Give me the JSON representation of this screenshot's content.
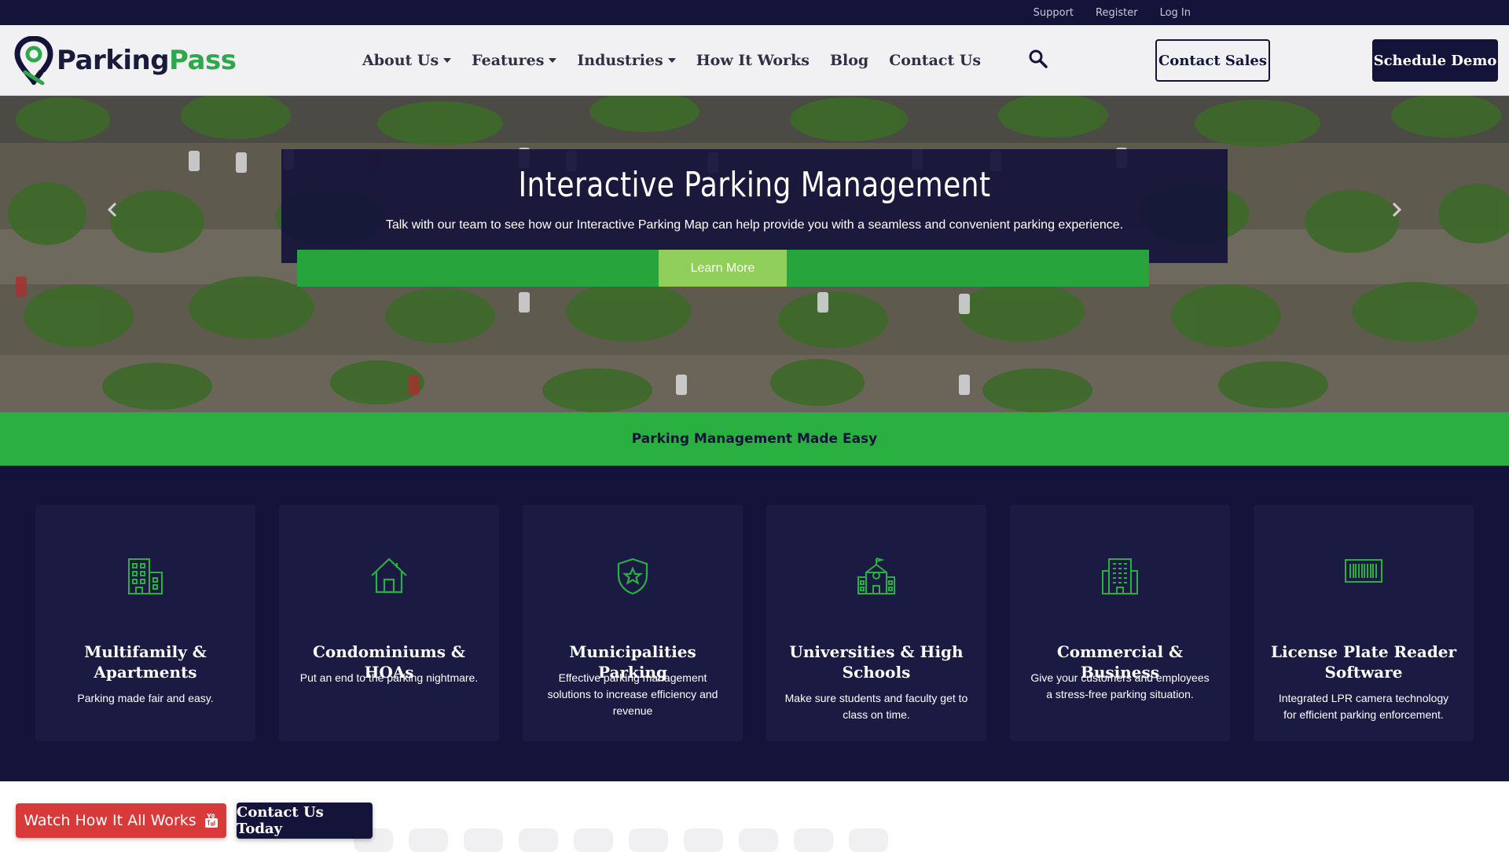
{
  "utility": {
    "links": [
      "Support",
      "Register",
      "Log In"
    ]
  },
  "brand": {
    "part1": "Parking",
    "part2": "Pass",
    "colors": {
      "navy": "#14133a",
      "green": "#2ea84a"
    }
  },
  "nav": {
    "items": [
      {
        "label": "About Us",
        "dropdown": true
      },
      {
        "label": "Features",
        "dropdown": true
      },
      {
        "label": "Industries",
        "dropdown": true
      },
      {
        "label": "How It Works",
        "dropdown": false
      },
      {
        "label": "Blog",
        "dropdown": false
      },
      {
        "label": "Contact Us",
        "dropdown": false
      }
    ],
    "search_icon": "search-icon",
    "contact_sales": "Contact Sales",
    "schedule_demo": "Schedule Demo"
  },
  "hero": {
    "title": "Interactive Parking Management",
    "subtitle": "Talk with our team to see how our Interactive Parking Map can help provide you with a seamless and convenient parking experience.",
    "cta": "Learn More"
  },
  "tagline": "Parking Management Made Easy",
  "industries": [
    {
      "icon": "apartment-building-icon",
      "title": "Multifamily & Apartments",
      "desc": "Parking made fair and easy."
    },
    {
      "icon": "house-icon",
      "title": "Condominiums & HOAs",
      "desc": "Put an end to the parking nightmare."
    },
    {
      "icon": "shield-star-icon",
      "title": "Municipalities Parking",
      "desc": "Effective parking management solutions to increase efficiency and revenue"
    },
    {
      "icon": "school-building-icon",
      "title": "Universities & High Schools",
      "desc": "Make sure students and faculty get to class on time."
    },
    {
      "icon": "office-building-icon",
      "title": "Commercial & Business",
      "desc": "Give your customers and employees a stress-free parking situation."
    },
    {
      "icon": "barcode-icon",
      "title": "License Plate Reader Software",
      "desc": "Integrated LPR camera technology for efficient parking enforcement."
    }
  ],
  "floating": {
    "watch": "Watch How It All Works",
    "contact_today": "Contact Us Today"
  }
}
